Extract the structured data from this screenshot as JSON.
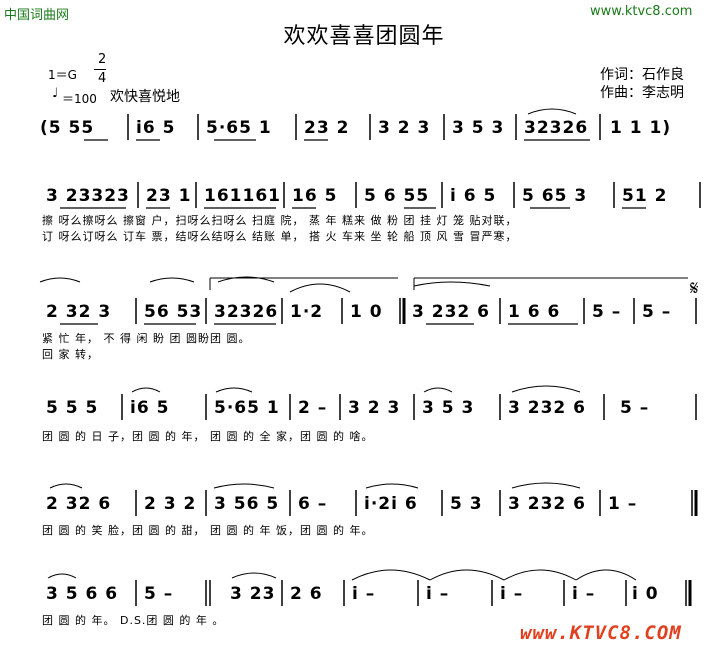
{
  "header": {
    "site_left": "中国词曲网",
    "site_right": "www.ktvc8.com",
    "title": "欢欢喜喜团圆年",
    "lyricist": "作词：石作良",
    "composer": "作曲：李志明",
    "key": "1＝G",
    "time_top": "2",
    "time_bottom": "4",
    "tempo": "＝100",
    "expression": "欢快喜悦地"
  },
  "rows": [
    {
      "notes": [
        "(5  55",
        "i6 5",
        "5·65 1",
        "23 2",
        "3 2 3",
        "3 5 3",
        "32326",
        "1  1 1)"
      ]
    },
    {
      "notes": [
        "3 23323",
        "23 1",
        "161161",
        "16 5",
        "5 6 55",
        "i 6 5",
        "5 65 3",
        "51 2"
      ],
      "lyrics1": "擦 呀么擦呀么 擦窗 户，扫呀么扫呀么 扫庭 院， 蒸 年 糕来 做 粉 团 挂  灯 笼  贴对联，",
      "lyrics2": "订 呀么订呀么 订车 票，结呀么结呀么 结账 单， 搭 火 车来 坐 轮 船 顶  风 雪  冒严寒，"
    },
    {
      "notes": [
        "2 32 3",
        "56 53",
        "32326",
        "1·2",
        "1 0",
        "3 232 6",
        "1 6 6",
        "5 –",
        "5 –"
      ],
      "lyrics1": "紧  忙      年，          不  得  闲        盼    团     圆盼团  圆。",
      "lyrics2": "回  家      转，"
    },
    {
      "notes": [
        "5  5 5",
        "i6 5",
        "5·65 1",
        "2 –",
        "3 2 3",
        "3 5 3",
        "3 232 6",
        "5 –"
      ],
      "lyrics1": "团  圆 的 日    子，团  圆 的 年，  团 圆 的 全    家，团    圆 的  啥。"
    },
    {
      "notes": [
        "2 32 6",
        "2 3 2",
        "3 56 5",
        "6 –",
        "i·2i 6",
        "5 3",
        "3 232 6",
        "1 –"
      ],
      "lyrics1": "团  圆 的  笑    脸，团  圆 的 甜，    团  圆 的 年   饭，团    圆 的 年。"
    },
    {
      "notes": [
        "3 5 6 6",
        "5 –",
        "3 23",
        "2 6",
        "i –",
        "i –",
        "i –",
        "i –",
        "i 0"
      ],
      "lyrics1": "团  圆 的 年。 D.S.团    圆 的     年    。"
    }
  ],
  "watermark": "www.KTVC8.COM",
  "repeat_sign": "𝄋"
}
